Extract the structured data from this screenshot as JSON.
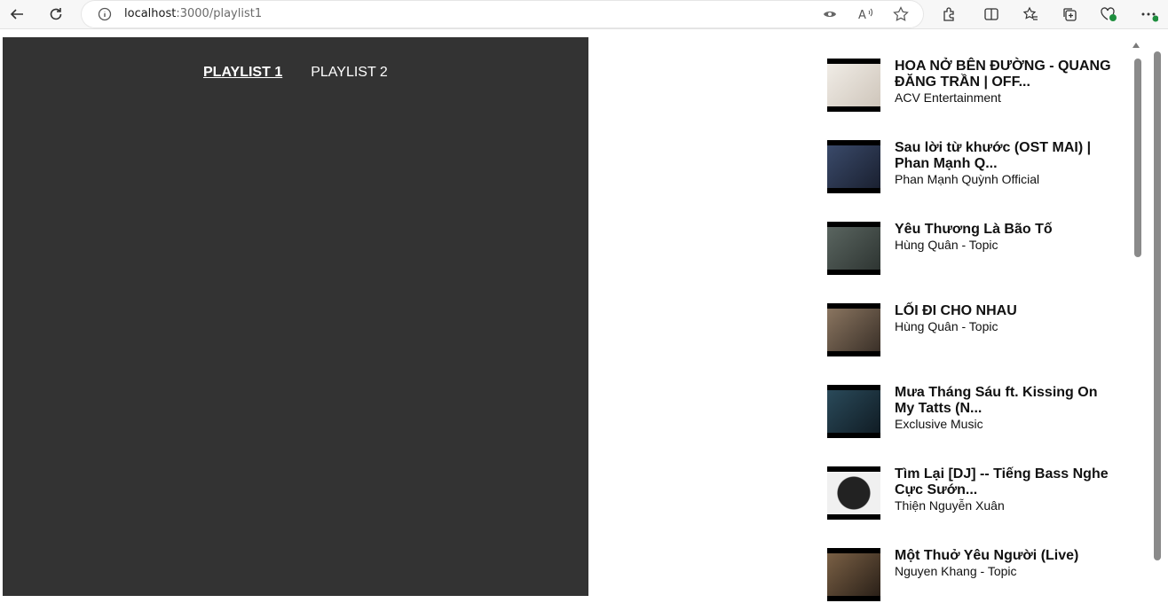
{
  "browser": {
    "url_host": "localhost",
    "url_port_path": ":3000/playlist1"
  },
  "tabs": [
    {
      "label": "PLAYLIST 1",
      "active": true
    },
    {
      "label": "PLAYLIST 2",
      "active": false
    }
  ],
  "playlist": [
    {
      "title": "HOA NỞ BÊN ĐƯỜNG - QUANG ĐĂNG TRẦN | OFF...",
      "channel": "ACV Entertainment",
      "thumb_color": "#e8e2da"
    },
    {
      "title": "Sau lời từ khước (OST MAI) | Phan Mạnh Q...",
      "channel": "Phan Mạnh Quỳnh Official",
      "thumb_color": "#2b3550"
    },
    {
      "title": "Yêu Thương Là Bão Tố",
      "channel": "Hùng Quân - Topic",
      "thumb_color": "#4a5550"
    },
    {
      "title": "LỐI ĐI CHO NHAU",
      "channel": "Hùng Quân - Topic",
      "thumb_color": "#6a5a4a"
    },
    {
      "title": "Mưa Tháng Sáu ft. Kissing On My Tatts (N...",
      "channel": "Exclusive Music",
      "thumb_color": "#1e3a4a"
    },
    {
      "title": "Tìm Lại [DJ] -- Tiếng Bass Nghe Cực Sướn...",
      "channel": "Thiện Nguyễn Xuân",
      "thumb_color": "#e8e8e8"
    },
    {
      "title": "Một Thuở Yêu Người (Live)",
      "channel": "Nguyen Khang - Topic",
      "thumb_color": "#5a4632"
    }
  ]
}
